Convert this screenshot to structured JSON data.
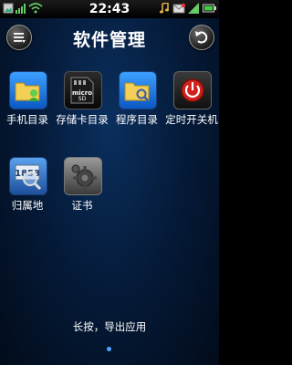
{
  "status_bar": {
    "time": "22:43",
    "icons": [
      "gallery-icon",
      "signal-icon",
      "wifi-icon",
      "music-icon",
      "email-icon",
      "signal-bars-icon",
      "battery-icon"
    ]
  },
  "header": {
    "title": "软件管理",
    "menu_icon": "menu-icon",
    "back_icon": "back-icon"
  },
  "apps": [
    {
      "label": "手机目录",
      "icon": "phone-folder-icon"
    },
    {
      "label": "存储卡目录",
      "icon": "sd-card-icon"
    },
    {
      "label": "程序目录",
      "icon": "program-folder-icon"
    },
    {
      "label": "定时开关机",
      "icon": "power-icon"
    },
    {
      "label": "归属地",
      "icon": "number-lookup-icon"
    },
    {
      "label": "证书",
      "icon": "certificate-icon"
    }
  ],
  "footer": {
    "hint": "长按，导出应用"
  },
  "colors": {
    "background": "#051a38",
    "accent": "#4ea5ff",
    "power_red": "#d0211c"
  }
}
